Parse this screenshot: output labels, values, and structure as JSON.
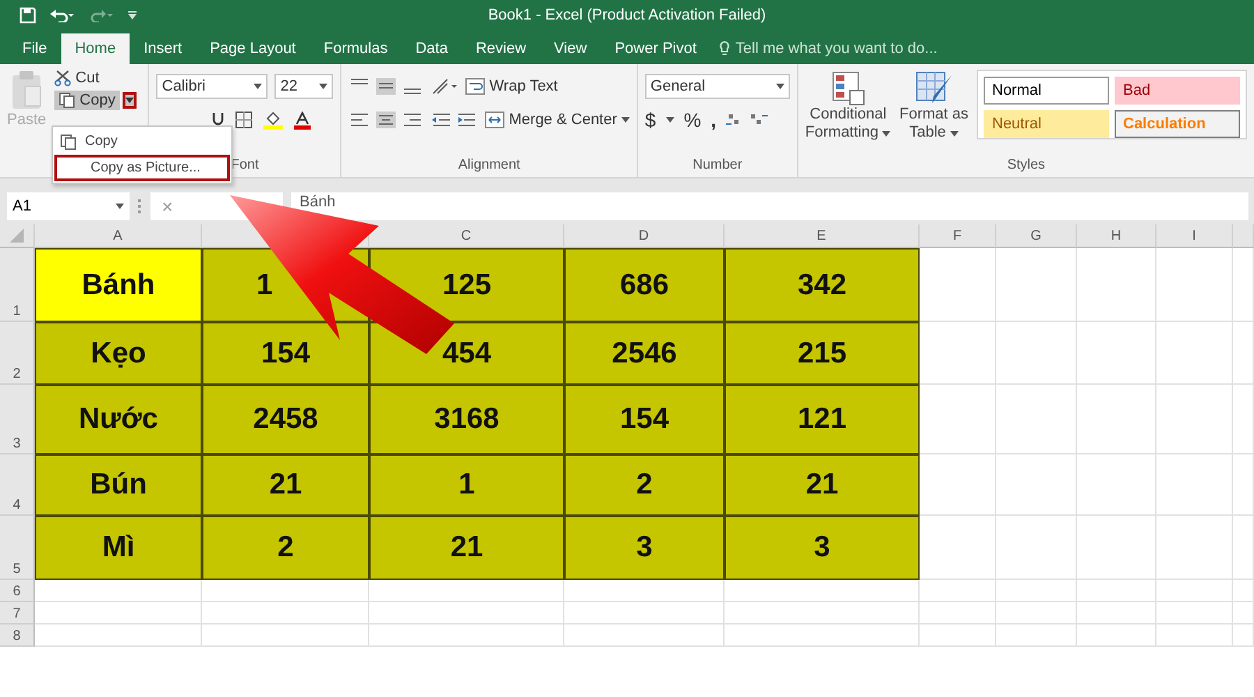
{
  "window": {
    "title": "Book1 - Excel (Product Activation Failed)"
  },
  "tabs": [
    {
      "label": "File",
      "selected": false
    },
    {
      "label": "Home",
      "selected": true
    },
    {
      "label": "Insert",
      "selected": false
    },
    {
      "label": "Page Layout",
      "selected": false
    },
    {
      "label": "Formulas",
      "selected": false
    },
    {
      "label": "Data",
      "selected": false
    },
    {
      "label": "Review",
      "selected": false
    },
    {
      "label": "View",
      "selected": false
    },
    {
      "label": "Power Pivot",
      "selected": false
    }
  ],
  "tell_me": {
    "placeholder": "Tell me what you want to do..."
  },
  "clipboard": {
    "paste": "Paste",
    "cut": "Cut",
    "copy": "Copy",
    "copy_caret_outlined": true
  },
  "copy_menu": [
    {
      "label": "Copy",
      "outlined": false
    },
    {
      "label": "Copy as Picture...",
      "outlined": true
    }
  ],
  "font": {
    "name": "Calibri",
    "size": "22",
    "group_label": "Font"
  },
  "alignment": {
    "wrap": "Wrap Text",
    "merge": "Merge & Center",
    "group_label": "Alignment"
  },
  "number": {
    "format": "General",
    "currency": "$",
    "percent": "%",
    "comma": ",",
    "group_label": "Number"
  },
  "styles": {
    "conditional": "Conditional",
    "conditional_2": "Formatting",
    "table": "Format as",
    "table_2": "Table",
    "group_label": "Styles",
    "gallery": [
      {
        "label": "Normal",
        "kind": "normal"
      },
      {
        "label": "Bad",
        "kind": "bad"
      },
      {
        "label": "Neutral",
        "kind": "neutral"
      },
      {
        "label": "Calculation",
        "kind": "calculation"
      }
    ]
  },
  "formula_bar": {
    "name_box": "A1",
    "cancel": "×",
    "value": "Bánh"
  },
  "sheet": {
    "columns": [
      "A",
      null,
      "C",
      "D",
      "E",
      "F",
      "G",
      "H",
      "I"
    ],
    "rows": [
      {
        "number": "1",
        "cells": [
          {
            "text": "Bánh",
            "color": "#ffff00"
          },
          {
            "text": "1",
            "color": "#c5c500"
          },
          {
            "text": "125",
            "color": "#c5c500"
          },
          {
            "text": "686",
            "color": "#c5c500"
          },
          {
            "text": "342",
            "color": "#c5c500"
          }
        ]
      },
      {
        "number": "2",
        "cells": [
          {
            "text": "Kẹo",
            "color": "#c5c500"
          },
          {
            "text": "154",
            "color": "#c5c500"
          },
          {
            "text": "454",
            "color": "#c5c500"
          },
          {
            "text": "2546",
            "color": "#c5c500"
          },
          {
            "text": "215",
            "color": "#c5c500"
          }
        ]
      },
      {
        "number": "3",
        "cells": [
          {
            "text": "Nước",
            "color": "#c5c500"
          },
          {
            "text": "2458",
            "color": "#c5c500"
          },
          {
            "text": "3168",
            "color": "#c5c500"
          },
          {
            "text": "154",
            "color": "#c5c500"
          },
          {
            "text": "121",
            "color": "#c5c500"
          }
        ]
      },
      {
        "number": "4",
        "cells": [
          {
            "text": "Bún",
            "color": "#c5c500"
          },
          {
            "text": "21",
            "color": "#c5c500"
          },
          {
            "text": "1",
            "color": "#c5c500"
          },
          {
            "text": "2",
            "color": "#c5c500"
          },
          {
            "text": "21",
            "color": "#c5c500"
          }
        ]
      },
      {
        "number": "5",
        "cells": [
          {
            "text": "Mì",
            "color": "#c5c500"
          },
          {
            "text": "2",
            "color": "#c5c500"
          },
          {
            "text": "21",
            "color": "#c5c500"
          },
          {
            "text": "3",
            "color": "#c5c500"
          },
          {
            "text": "3",
            "color": "#c5c500"
          }
        ]
      },
      {
        "number": "6",
        "cells": []
      },
      {
        "number": "7",
        "cells": []
      },
      {
        "number": "8",
        "cells": []
      }
    ]
  }
}
